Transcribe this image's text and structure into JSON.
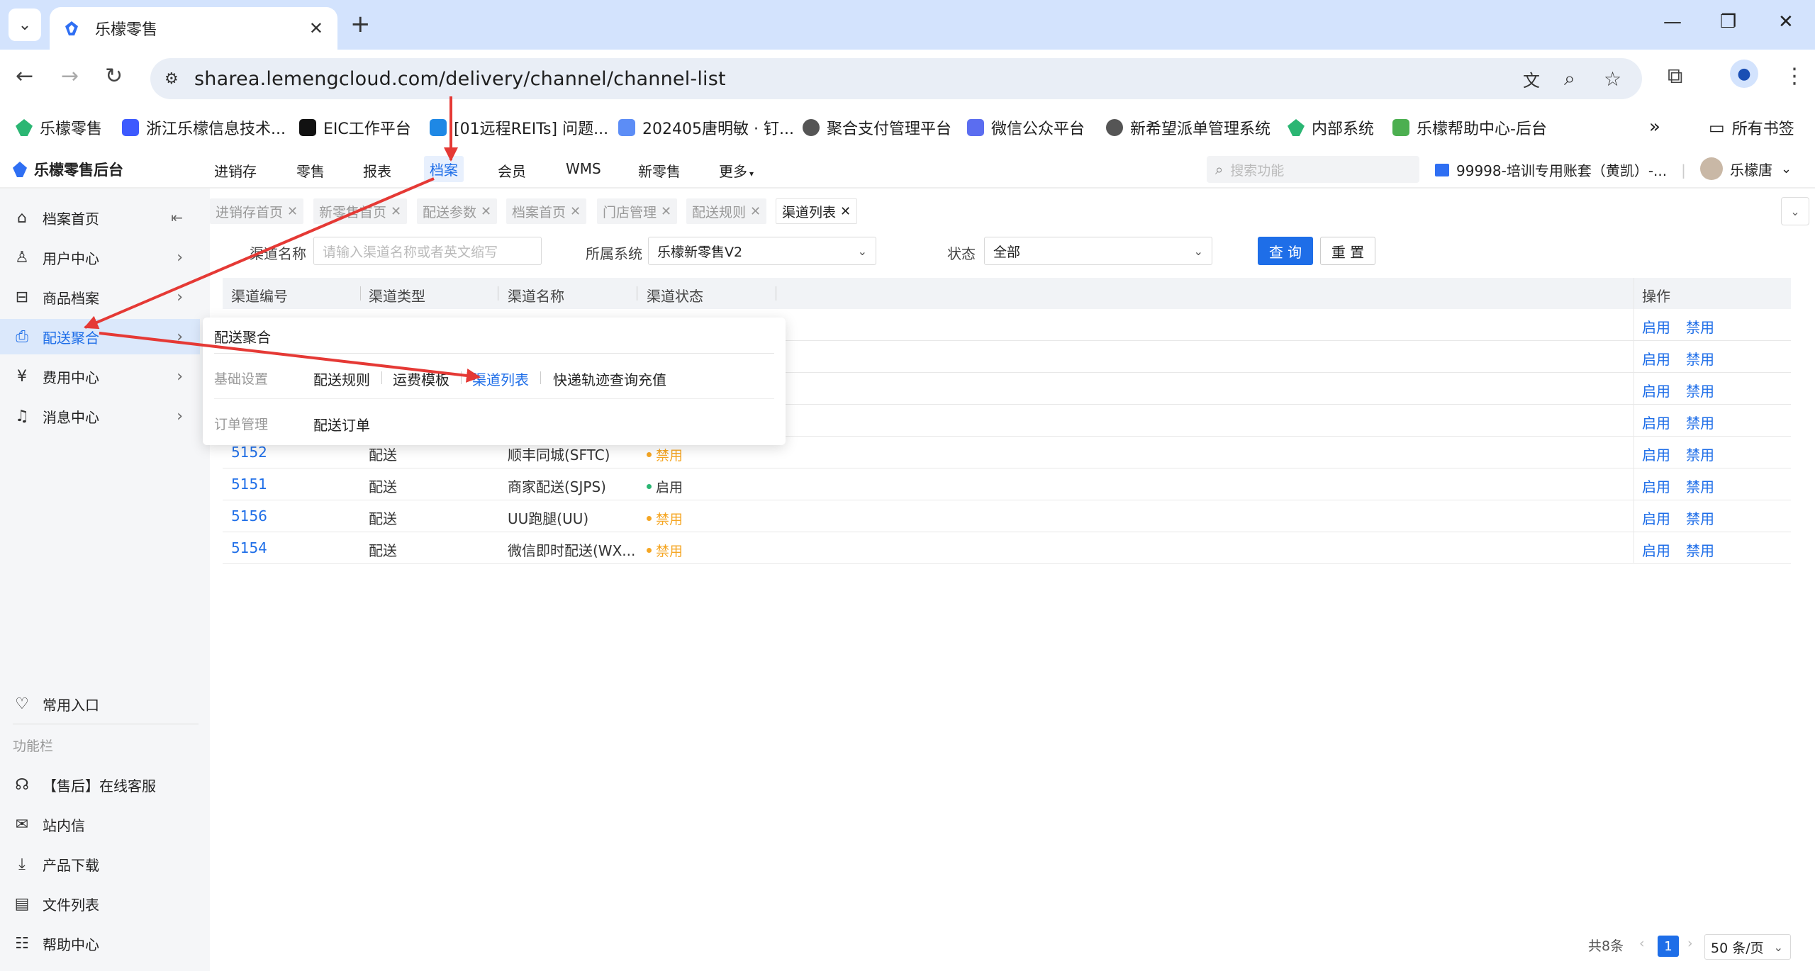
{
  "browser": {
    "tab_title": "乐檬零售",
    "url": "sharea.lemengcloud.com/delivery/channel/channel-list",
    "bookmarks": [
      "乐檬零售",
      "浙江乐檬信息技术...",
      "EIC工作平台",
      "[01远程REITs] 问题...",
      "202405唐明敏 · 钉...",
      "聚合支付管理平台",
      "微信公众平台",
      "新希望派单管理系统",
      "内部系统",
      "乐檬帮助中心-后台"
    ],
    "all_bookmarks": "所有书签"
  },
  "app": {
    "logo": "乐檬零售后台",
    "nav": [
      "进销存",
      "零售",
      "报表",
      "档案",
      "会员",
      "WMS",
      "新零售",
      "更多"
    ],
    "search_placeholder": "搜索功能",
    "account": "99998-培训专用账套（黄凯）-...",
    "user": "乐檬唐"
  },
  "sidebar": {
    "items": [
      "档案首页",
      "用户中心",
      "商品档案",
      "配送聚合",
      "费用中心",
      "消息中心"
    ],
    "common": "常用入口",
    "func_label": "功能栏",
    "func_items": [
      "【售后】在线客服",
      "站内信",
      "产品下载",
      "文件列表",
      "帮助中心"
    ]
  },
  "page_tabs": [
    "进销存首页",
    "新零售首页",
    "配送参数",
    "档案首页",
    "门店管理",
    "配送规则",
    "渠道列表"
  ],
  "filters": {
    "name_label": "渠道名称",
    "name_placeholder": "请输入渠道名称或者英文缩写",
    "system_label": "所属系统",
    "system_value": "乐檬新零售V2",
    "status_label": "状态",
    "status_value": "全部",
    "query_btn": "查 询",
    "reset_btn": "重 置"
  },
  "table": {
    "headers": [
      "渠道编号",
      "渠道类型",
      "渠道名称",
      "渠道状态",
      "操作"
    ],
    "rows": [
      {
        "code": "5152",
        "type": "配送",
        "name": "顺丰同城(SFTC)",
        "status": "禁用",
        "on": "启用",
        "off": "禁用"
      },
      {
        "code": "5151",
        "type": "配送",
        "name": "商家配送(SJPS)",
        "status": "启用",
        "on": "启用",
        "off": "禁用"
      },
      {
        "code": "5156",
        "type": "配送",
        "name": "UU跑腿(UU)",
        "status": "禁用",
        "on": "启用",
        "off": "禁用"
      },
      {
        "code": "5154",
        "type": "配送",
        "name": "微信即时配送(WX...",
        "status": "禁用",
        "on": "启用",
        "off": "禁用"
      }
    ],
    "hidden_rows_ops": {
      "on": "启用",
      "off": "禁用"
    }
  },
  "popup": {
    "title": "配送聚合",
    "group1": "基础设置",
    "links1": [
      "配送规则",
      "运费模板",
      "渠道列表",
      "快递轨迹查询充值"
    ],
    "group2": "订单管理",
    "links2": [
      "配送订单"
    ]
  },
  "pagination": {
    "total": "共8条",
    "page": "1",
    "size": "50 条/页"
  },
  "colors": {
    "accent": "#1e6ee8",
    "enabled": "#2bb673",
    "disabled": "#f5a623",
    "annotation": "#e53935"
  }
}
